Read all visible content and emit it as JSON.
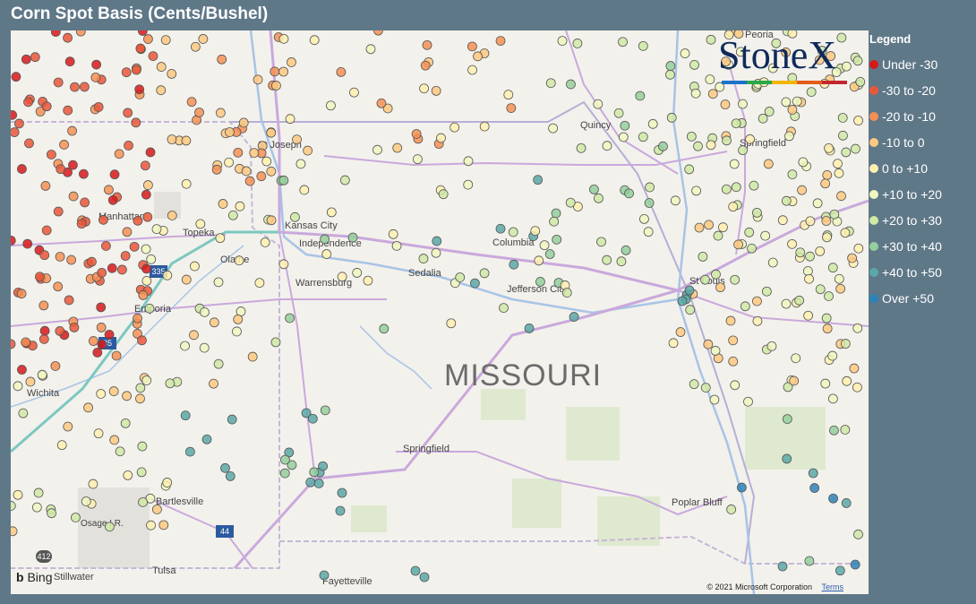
{
  "title": "Corn Spot Basis (Cents/Bushel)",
  "map": {
    "state_label": "MISSOURI",
    "bing_label": "Bing",
    "copyright": "© 2021 Microsoft Corporation",
    "terms_label": "Terms",
    "cities": [
      "St Joseph",
      "Manhattan",
      "Topeka",
      "Kansas City",
      "Independence",
      "Olathe",
      "Emporia",
      "Warrensburg",
      "Sedalia",
      "Columbia",
      "Jefferson City",
      "St Louis",
      "Springfield",
      "Wichita",
      "Bartlesville",
      "Osage I.R.",
      "Tulsa",
      "Stillwater",
      "Fayetteville",
      "Poplar Bluff",
      "Quincy",
      "Peoria"
    ],
    "shields": [
      "335",
      "35",
      "44",
      "412"
    ]
  },
  "logo": {
    "text": "StoneX",
    "colors": [
      "#1a73c8",
      "#2aa84a",
      "#f2b600",
      "#e35b18",
      "#c1272d"
    ]
  },
  "legend": {
    "title": "Legend",
    "items": [
      {
        "label": "Under -30",
        "color": "#d7191c"
      },
      {
        "label": "-30 to -20",
        "color": "#e9573a"
      },
      {
        "label": "-20 to -10",
        "color": "#f59053"
      },
      {
        "label": "-10 to 0",
        "color": "#fdc980"
      },
      {
        "label": "0 to +10",
        "color": "#fef0b0"
      },
      {
        "label": "+10 to +20",
        "color": "#f0f7c0"
      },
      {
        "label": "+20 to +30",
        "color": "#cfe9a6"
      },
      {
        "label": "+30 to +40",
        "color": "#94cf9c"
      },
      {
        "label": "+40 to +50",
        "color": "#5aa8a8"
      },
      {
        "label": "Over +50",
        "color": "#2b83ba"
      }
    ]
  }
}
